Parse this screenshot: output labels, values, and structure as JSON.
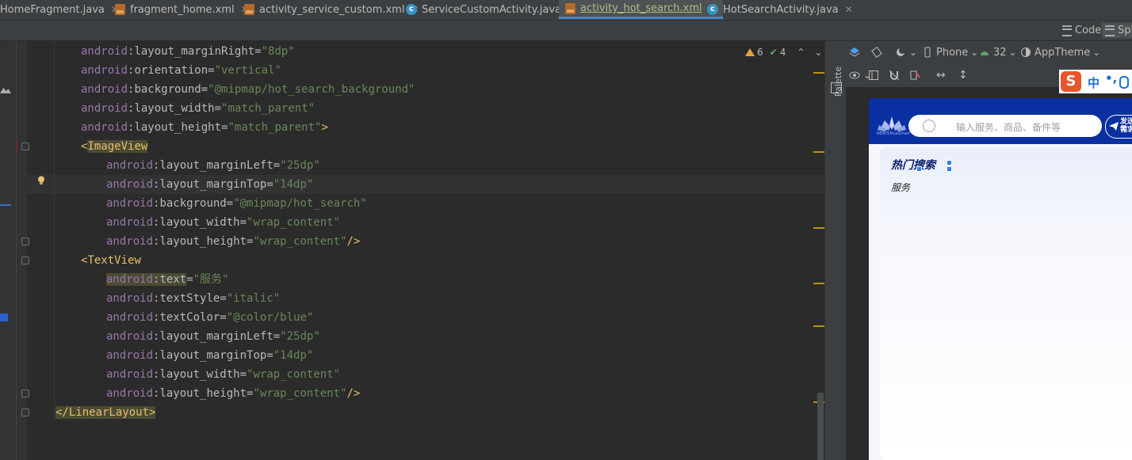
{
  "tabs": [
    {
      "label": "HomeFragment.java",
      "type": "java"
    },
    {
      "label": "fragment_home.xml",
      "type": "xml"
    },
    {
      "label": "activity_service_custom.xml",
      "type": "xml"
    },
    {
      "label": "ServiceCustomActivity.java",
      "type": "java"
    },
    {
      "label": "activity_hot_search.xml",
      "type": "xml",
      "active": true
    },
    {
      "label": "HotSearchActivity.java",
      "type": "java"
    }
  ],
  "tab_close": "✕",
  "view_modes": {
    "code": "Code",
    "split": "Spl"
  },
  "inspections": {
    "warnings": "6",
    "weak_warnings": "4"
  },
  "code_lines": [
    {
      "indent": 1,
      "ns": "android",
      "attr": "layout_marginRight",
      "value": "\"8dp\""
    },
    {
      "indent": 1,
      "ns": "android",
      "attr": "orientation",
      "value": "\"vertical\""
    },
    {
      "indent": 1,
      "ns": "android",
      "attr": "background",
      "value": "\"@mipmap/hot_search_background\""
    },
    {
      "indent": 1,
      "ns": "android",
      "attr": "layout_width",
      "value": "\"match_parent\""
    },
    {
      "indent": 1,
      "ns": "android",
      "attr": "layout_height",
      "value": "\"match_parent\"",
      "end": ">"
    },
    {
      "indent": 1,
      "tag_open": "<",
      "tag": "ImageView"
    },
    {
      "indent": 2,
      "ns": "android",
      "attr": "layout_marginLeft",
      "value": "\"25dp\""
    },
    {
      "indent": 2,
      "ns": "android",
      "attr": "layout_marginTop",
      "value": "\"14dp\""
    },
    {
      "indent": 2,
      "ns": "android",
      "attr": "background",
      "value": "\"@mipmap/hot_search\""
    },
    {
      "indent": 2,
      "ns": "android",
      "attr": "layout_width",
      "value": "\"wrap_content\""
    },
    {
      "indent": 2,
      "ns": "android",
      "attr": "layout_height",
      "value": "\"wrap_content\"",
      "end": "/>"
    },
    {
      "indent": 1,
      "tag_open": "<",
      "tag": "TextView"
    },
    {
      "indent": 2,
      "ns": "android",
      "attr": "text",
      "value": "\"服务\""
    },
    {
      "indent": 2,
      "ns": "android",
      "attr": "textStyle",
      "value": "\"italic\""
    },
    {
      "indent": 2,
      "ns": "android",
      "attr": "textColor",
      "value": "\"@color/blue\""
    },
    {
      "indent": 2,
      "ns": "android",
      "attr": "layout_marginLeft",
      "value": "\"25dp\""
    },
    {
      "indent": 2,
      "ns": "android",
      "attr": "layout_marginTop",
      "value": "\"14dp\""
    },
    {
      "indent": 2,
      "ns": "android",
      "attr": "layout_width",
      "value": "\"wrap_content\""
    },
    {
      "indent": 2,
      "ns": "android",
      "attr": "layout_height",
      "value": "\"wrap_content\"",
      "end": "/>"
    },
    {
      "indent": 0,
      "tag_open": "</",
      "tag": "LinearLayout",
      "end": ">"
    }
  ],
  "palette_label": "Palette",
  "design_toolbar": {
    "device": "Phone",
    "api": "32",
    "theme": "AppTheme"
  },
  "ime": {
    "logo": "S",
    "mode": "中",
    "punct": "•,"
  },
  "preview": {
    "logo_text": "NEW3/HuaSmart",
    "search_placeholder": "输入服务、商品、备件等",
    "send_label": "发送\n需求",
    "hot_title": "热门搜索",
    "hot_subtitle": "服务"
  },
  "colors": {
    "editor_bg": "#2b2b2b",
    "attr_ns": "#9876aa",
    "attr_value": "#6a8759",
    "tag": "#e8bf6a",
    "phone_header": "#0a2fa0"
  }
}
